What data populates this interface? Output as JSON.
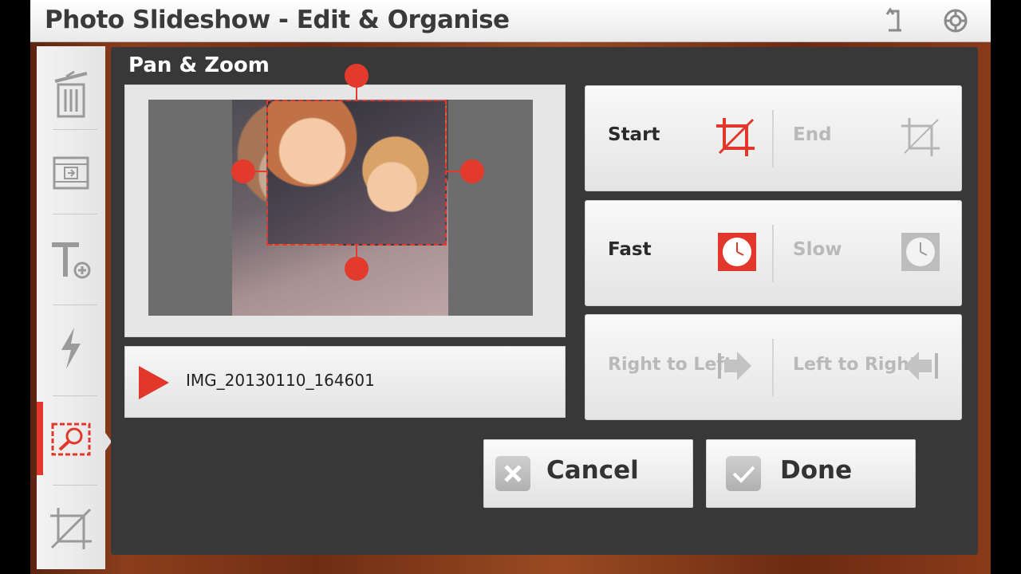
{
  "app": {
    "title": "Photo Slideshow - Edit & Organise"
  },
  "titlebar": {
    "back_icon": "back-icon",
    "settings_icon": "settings-icon"
  },
  "sidebar": {
    "items": [
      {
        "name": "delete",
        "icon": "trash-icon",
        "active": false
      },
      {
        "name": "transition",
        "icon": "film-transition-icon",
        "active": false
      },
      {
        "name": "add-text",
        "icon": "text-add-icon",
        "active": false
      },
      {
        "name": "effects",
        "icon": "lightning-icon",
        "active": false
      },
      {
        "name": "pan-zoom",
        "icon": "pan-zoom-icon",
        "active": true
      },
      {
        "name": "crop",
        "icon": "crop-icon",
        "active": false
      }
    ]
  },
  "panel": {
    "title": "Pan & Zoom",
    "file_name": "IMG_20130110_164601"
  },
  "options": {
    "start_label": "Start",
    "end_label": "End",
    "fast_label": "Fast",
    "slow_label": "Slow",
    "rtl_label": "Right to Left",
    "ltr_label": "Left to Right"
  },
  "actions": {
    "cancel_label": "Cancel",
    "done_label": "Done"
  },
  "colors": {
    "accent": "#e2382b",
    "panel": "#383838",
    "disabled": "#b9b9b9"
  }
}
